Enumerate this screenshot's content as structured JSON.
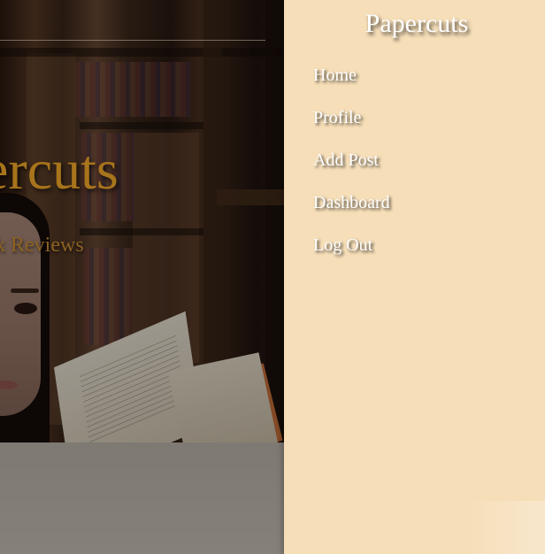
{
  "hero": {
    "title": "Papercuts",
    "subtitle": "Book Reviews"
  },
  "drawer": {
    "title": "Papercuts",
    "items": [
      {
        "label": "Home"
      },
      {
        "label": "Profile"
      },
      {
        "label": "Add Post"
      },
      {
        "label": "Dashboard"
      },
      {
        "label": "Log Out"
      }
    ]
  },
  "colors": {
    "drawer_bg": "#f6deb8",
    "hero_title": "#a8741c",
    "overlay": "#8a8580"
  }
}
